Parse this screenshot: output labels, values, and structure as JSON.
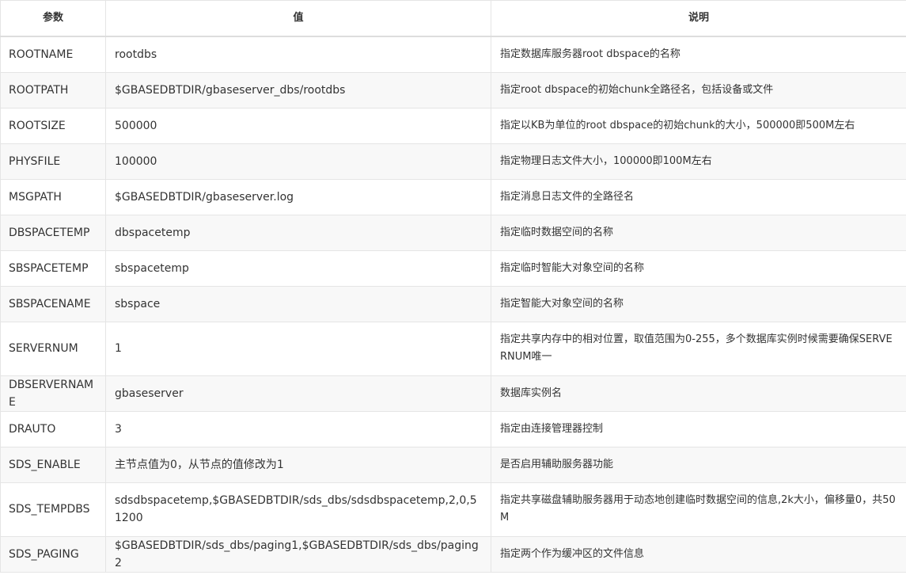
{
  "table": {
    "headers": [
      "参数",
      "值",
      "说明"
    ],
    "rows": [
      {
        "param": "ROOTNAME",
        "value": "rootdbs",
        "desc": "指定数据库服务器root dbspace的名称"
      },
      {
        "param": "ROOTPATH",
        "value": "$GBASEDBTDIR/gbaseserver_dbs/rootdbs",
        "desc": "指定root dbspace的初始chunk全路径名，包括设备或文件"
      },
      {
        "param": "ROOTSIZE",
        "value": "500000",
        "desc": "指定以KB为单位的root dbspace的初始chunk的大小，500000即500M左右"
      },
      {
        "param": "PHYSFILE",
        "value": "100000",
        "desc": "指定物理日志文件大小，100000即100M左右"
      },
      {
        "param": "MSGPATH",
        "value": "$GBASEDBTDIR/gbaseserver.log",
        "desc": "指定消息日志文件的全路径名"
      },
      {
        "param": "DBSPACETEMP",
        "value": "dbspacetemp",
        "desc": "指定临时数据空间的名称"
      },
      {
        "param": "SBSPACETEMP",
        "value": "sbspacetemp",
        "desc": "指定临时智能大对象空间的名称"
      },
      {
        "param": "SBSPACENAME",
        "value": "sbspace",
        "desc": "指定智能大对象空间的名称"
      },
      {
        "param": "SERVERNUM",
        "value": "1",
        "desc": "指定共享内存中的相对位置，取值范围为0-255，多个数据库实例时候需要确保SERVERNUM唯一"
      },
      {
        "param": "DBSERVERNAME",
        "value": "gbaseserver",
        "desc": "数据库实例名"
      },
      {
        "param": "DRAUTO",
        "value": "3",
        "desc": "指定由连接管理器控制"
      },
      {
        "param": "SDS_ENABLE",
        "value": "主节点值为0，从节点的值修改为1",
        "desc": "是否启用辅助服务器功能"
      },
      {
        "param": "SDS_TEMPDBS",
        "value": "sdsdbspacetemp,$GBASEDBTDIR/sds_dbs/sdsdbspacetemp,2,0,51200",
        "desc": "指定共享磁盘辅助服务器用于动态地创建临时数据空间的信息,2k大小，偏移量0，共50M"
      },
      {
        "param": "SDS_PAGING",
        "value": "$GBASEDBTDIR/sds_dbs/paging1,$GBASEDBTDIR/sds_dbs/paging2",
        "desc": "指定两个作为缓冲区的文件信息"
      }
    ]
  }
}
